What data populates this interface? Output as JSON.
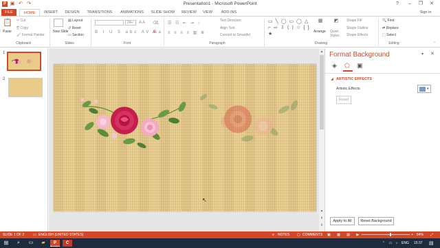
{
  "window": {
    "title": "Presentation1 - Microsoft PowerPoint",
    "sign_in": "Sign in",
    "help": "?",
    "min": "–",
    "restore": "❐",
    "close": "✕"
  },
  "quick_access": {
    "save": "▣",
    "undo": "↶",
    "redo": "↷"
  },
  "tabs": [
    "FILE",
    "HOME",
    "INSERT",
    "DESIGN",
    "TRANSITIONS",
    "ANIMATIONS",
    "SLIDE SHOW",
    "REVIEW",
    "VIEW",
    "ADD-INS"
  ],
  "ribbon": {
    "clipboard": {
      "paste": "Paste",
      "cut": "Cut",
      "copy": "Copy",
      "format_painter": "Format Painter",
      "label": "Clipboard"
    },
    "slides": {
      "new_slide": "New Slide",
      "layout": "Layout",
      "reset": "Reset",
      "section": "Section",
      "label": "Slides"
    },
    "font": {
      "size": "24+",
      "label": "Font"
    },
    "paragraph": {
      "text_direction": "Text Direction",
      "align_text": "Align Text",
      "smartart": "Convert to SmartArt",
      "label": "Paragraph"
    },
    "drawing": {
      "arrange": "Arrange",
      "quick_styles": "Quick Styles",
      "shape_fill": "Shape Fill",
      "shape_outline": "Shape Outline",
      "shape_effects": "Shape Effects",
      "label": "Drawing"
    },
    "editing": {
      "find": "Find",
      "replace": "Replace",
      "select": "Select",
      "label": "Editing"
    }
  },
  "slides": [
    {
      "number": "1",
      "selected": true
    },
    {
      "number": "2",
      "selected": false
    }
  ],
  "format_pane": {
    "title": "Format Background",
    "section": "ARTISTIC EFFECTS",
    "effects_label": "Artistic Effects",
    "reset": "Reset",
    "apply_all": "Apply to All",
    "reset_background": "Reset Background"
  },
  "status": {
    "slide": "SLIDE 1 OF 2",
    "language": "ENGLISH (UNITED STATES)",
    "notes": "NOTES",
    "comments": "COMMENTS",
    "zoom": "64%"
  },
  "taskbar": {
    "language": "ENG",
    "time": "15:37"
  },
  "colors": {
    "accent": "#d24726",
    "taskbar": "#1e2b3c"
  }
}
